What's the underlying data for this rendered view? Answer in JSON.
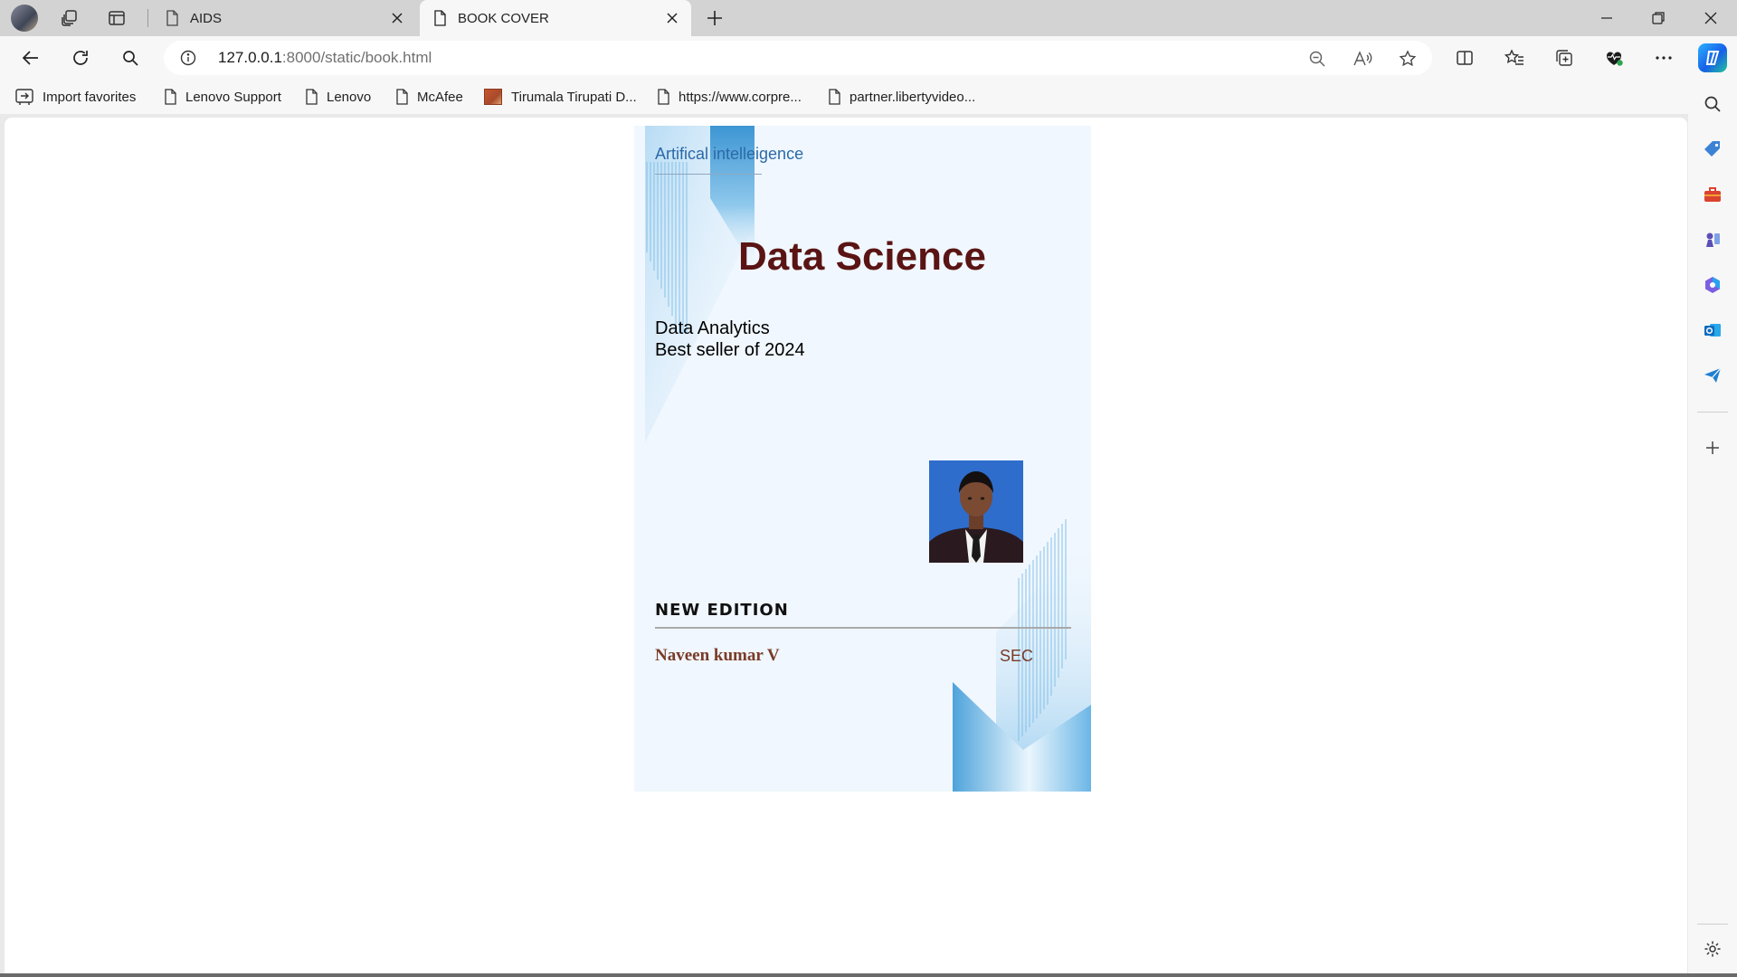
{
  "browser": {
    "tabs": [
      {
        "title": "AIDS",
        "active": false
      },
      {
        "title": "BOOK COVER",
        "active": true
      }
    ],
    "address": {
      "host": "127.0.0.1",
      "path": ":8000/static/book.html"
    },
    "favorites": [
      {
        "label": "Import favorites",
        "icon": "import-icon"
      },
      {
        "label": "Lenovo Support",
        "icon": "page-icon"
      },
      {
        "label": "Lenovo",
        "icon": "page-icon"
      },
      {
        "label": "McAfee",
        "icon": "page-icon"
      },
      {
        "label": "Tirumala Tirupati D...",
        "icon": "site-favicon"
      },
      {
        "label": "https://www.corpre...",
        "icon": "page-icon"
      },
      {
        "label": "partner.libertyvideo...",
        "icon": "page-icon"
      }
    ]
  },
  "cover": {
    "topic": "Artifical intelleigence",
    "title": "Data Science",
    "subtitle_line1": "Data Analytics",
    "subtitle_line2": "Best seller of 2024",
    "edition": "NEW EDITION",
    "author": "Naveen kumar V",
    "publisher": "SEC"
  },
  "colors": {
    "title": "#5a1414",
    "topic": "#2b6aa8",
    "author": "#7a3b28",
    "cover_bg": "#f0f7fe",
    "accent_blue": "#4fa3dc"
  }
}
